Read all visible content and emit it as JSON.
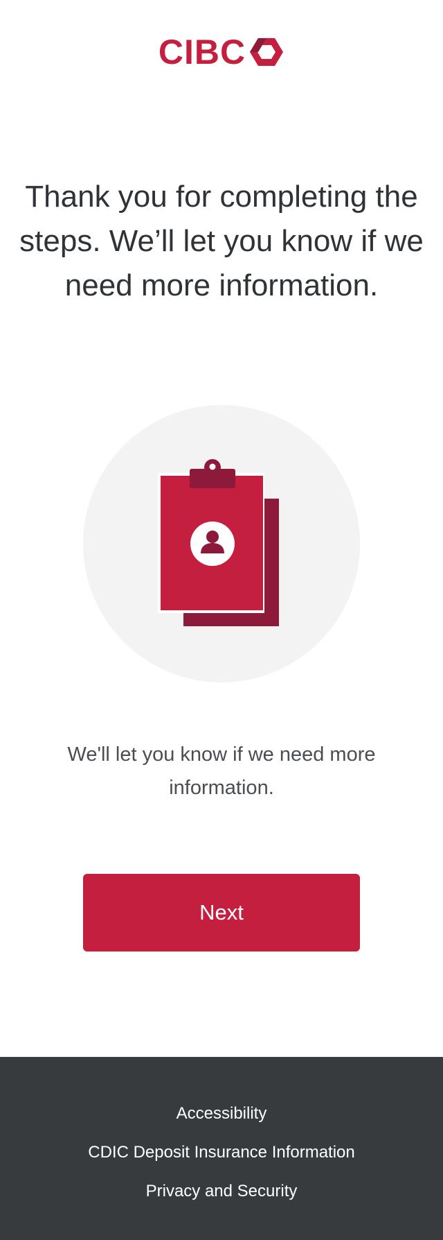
{
  "header": {
    "logo_text": "CIBC",
    "logo_icon": "cibc-diamond-icon",
    "brand_color": "#c41f3e"
  },
  "main": {
    "heading": "Thank you for completing the steps. We’ll let you know if we need more information.",
    "illustration_icon": "clipboard-user-icon",
    "message": "We'll let you know if we need more information.",
    "next_label": "Next"
  },
  "footer": {
    "background_color": "#383b3e",
    "links": [
      {
        "label": "Accessibility"
      },
      {
        "label": "CDIC Deposit Insurance Information"
      },
      {
        "label": "Privacy and Security"
      }
    ]
  }
}
